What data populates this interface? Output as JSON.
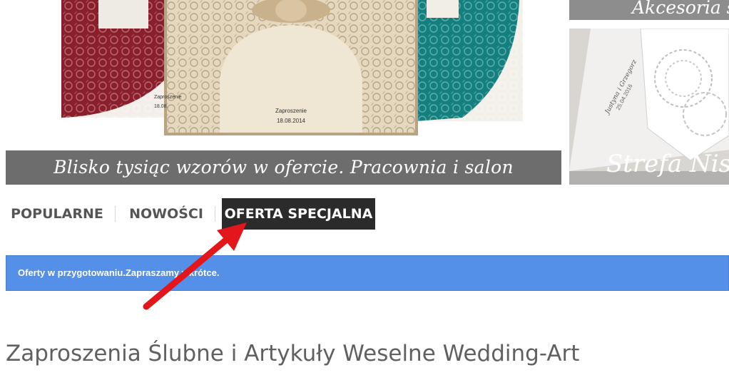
{
  "banner": {
    "caption": "Blisko tysiąc wzorów w ofercie. Pracownia i salon wzorniczy.",
    "card_red": {
      "line1": "Zaproszenie",
      "line2": "18.08."
    },
    "card_center": {
      "line1": "Zaproszenie",
      "line2": "18.08.2014"
    }
  },
  "side_tiles": {
    "top_label": "Akcesoria ślubne",
    "bottom_label": "Strefa Niskich Cen",
    "card_names": "Justyna i Grzegorz",
    "card_date": "25.04.2016"
  },
  "tabs": [
    {
      "label": "POPULARNE",
      "active": false
    },
    {
      "label": "NOWOŚCI",
      "active": false
    },
    {
      "label": "OFERTA SPECJALNA",
      "active": true
    }
  ],
  "info_bar": {
    "text": "Oferty w przygotowaniu.Zapraszamy wkrótce."
  },
  "main": {
    "title": "Zaproszenia Ślubne i Artykuły Weselne Wedding-Art",
    "intro": ""
  },
  "colors": {
    "info_bar": "#5590e8",
    "active_tab": "#2b2b2b",
    "arrow": "#e3161b",
    "caption_bar": "#6d6d6d"
  }
}
